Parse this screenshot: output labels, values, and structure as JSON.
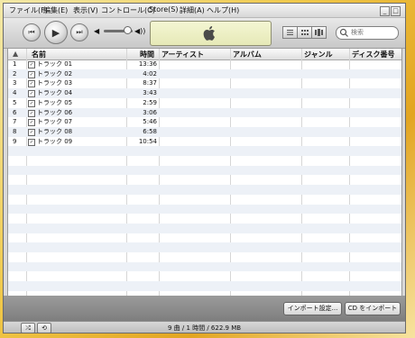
{
  "menu": [
    "ファイル(F)",
    "編集(E)",
    "表示(V)",
    "コントロール(C)",
    "Store(S)",
    "詳細(A)",
    "ヘルプ(H)"
  ],
  "window_buttons": [
    "_",
    "□",
    "×"
  ],
  "search": {
    "placeholder": "検索"
  },
  "columns": {
    "name": "名前",
    "time": "時間",
    "artist": "アーティスト",
    "album": "アルバム",
    "genre": "ジャンル",
    "disc": "ディスク番号"
  },
  "tracks": [
    {
      "no": "1",
      "title": "トラック 01",
      "time": "13:36"
    },
    {
      "no": "2",
      "title": "トラック 02",
      "time": "4:02"
    },
    {
      "no": "3",
      "title": "トラック 03",
      "time": "8:37"
    },
    {
      "no": "4",
      "title": "トラック 04",
      "time": "3:43"
    },
    {
      "no": "5",
      "title": "トラック 05",
      "time": "2:59"
    },
    {
      "no": "6",
      "title": "トラック 06",
      "time": "3:06"
    },
    {
      "no": "7",
      "title": "トラック 07",
      "time": "5:46"
    },
    {
      "no": "8",
      "title": "トラック 08",
      "time": "6:58"
    },
    {
      "no": "9",
      "title": "トラック 09",
      "time": "10:54"
    }
  ],
  "buttons": {
    "import_settings": "インポート設定...",
    "import_cd": "CD をインポート"
  },
  "status": "9 曲 / 1 時間 / 622.9 MB",
  "icons": {
    "prev": "⏮",
    "play": "▶",
    "next": "⏭",
    "shuffle": "⤮",
    "repeat": "⟲"
  }
}
